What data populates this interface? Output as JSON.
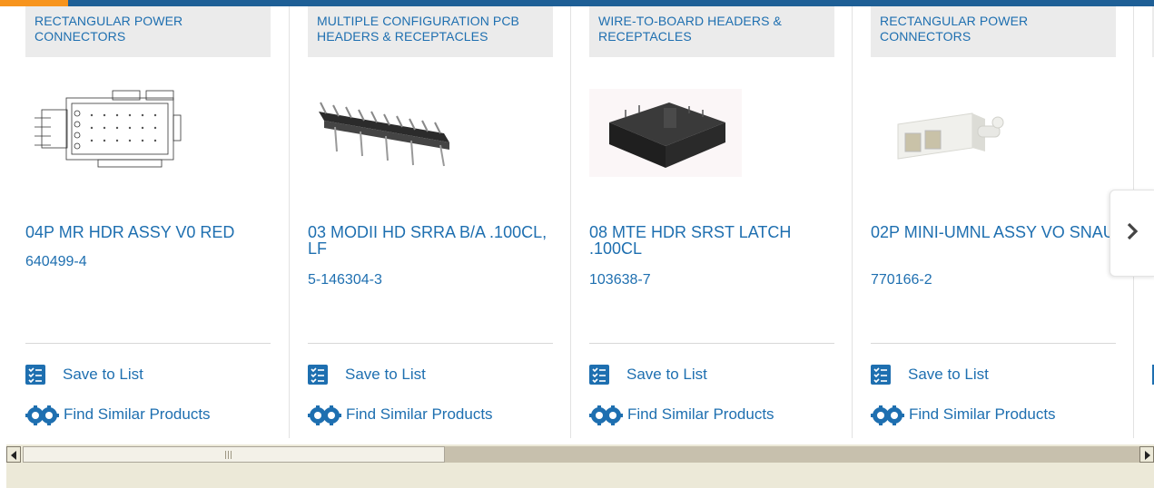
{
  "cards": [
    {
      "category": "RECTANGULAR POWER CONNECTORS",
      "title": "04P MR HDR ASSY V0 RED",
      "part_number": "640499-4",
      "save_label": "Save to List",
      "find_label": "Find Similar Products",
      "image_icon": "rectangular-power-connector-drawing"
    },
    {
      "category": "MULTIPLE CONFIGURATION PCB HEADERS & RECEPTACLES",
      "title": "03 MODII HD SRRA B/A .100CL, LF",
      "part_number": "5-146304-3",
      "save_label": "Save to List",
      "find_label": "Find Similar Products",
      "image_icon": "pin-header-photo"
    },
    {
      "category": "WIRE-TO-BOARD HEADERS & RECEPTACLES",
      "title": "08 MTE HDR SRST LATCH .100CL",
      "part_number": "103638-7",
      "save_label": "Save to List",
      "find_label": "Find Similar Products",
      "image_icon": "latch-header-photo"
    },
    {
      "category": "RECTANGULAR POWER CONNECTORS",
      "title": "02P MINI-UMNL ASSY VO SNAU",
      "part_number": "770166-2",
      "save_label": "Save to List",
      "find_label": "Find Similar Products",
      "image_icon": "mini-umnl-connector-photo"
    }
  ],
  "next_icon": "chevron-right-icon",
  "colors": {
    "link": "#1e6fb0",
    "top_bar": "#1e5f96",
    "top_accent": "#f7941d",
    "category_bg": "#ebebeb"
  }
}
